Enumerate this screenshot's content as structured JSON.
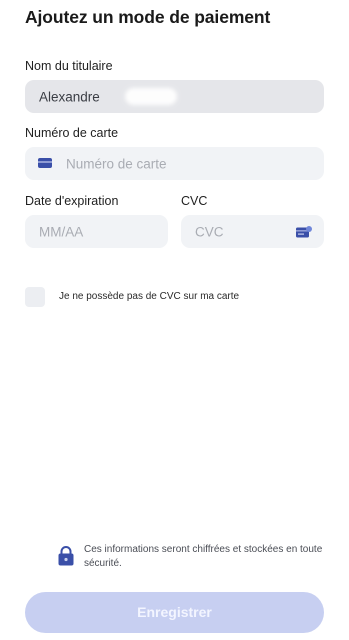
{
  "header": {
    "title": "Ajoutez un mode de paiement"
  },
  "form": {
    "holder": {
      "label": "Nom du titulaire",
      "value": "Alexandre"
    },
    "card_number": {
      "label": "Numéro de carte",
      "placeholder": "Numéro de carte",
      "icon": "credit-card-icon"
    },
    "expiry": {
      "label": "Date d'expiration",
      "placeholder": "MM/AA"
    },
    "cvc": {
      "label": "CVC",
      "placeholder": "CVC",
      "icon": "card-cvc-icon"
    },
    "no_cvc": {
      "label": "Je ne possède pas de CVC sur ma carte",
      "checked": false
    }
  },
  "footer": {
    "security_text": "Ces informations seront chiffrées et stockées en toute sécurité.",
    "security_icon": "lock-icon",
    "save_label": "Enregistrer"
  },
  "colors": {
    "accent": "#3a4fa8",
    "button_disabled": "#c7cff1",
    "field_bg": "#f1f3f6"
  }
}
